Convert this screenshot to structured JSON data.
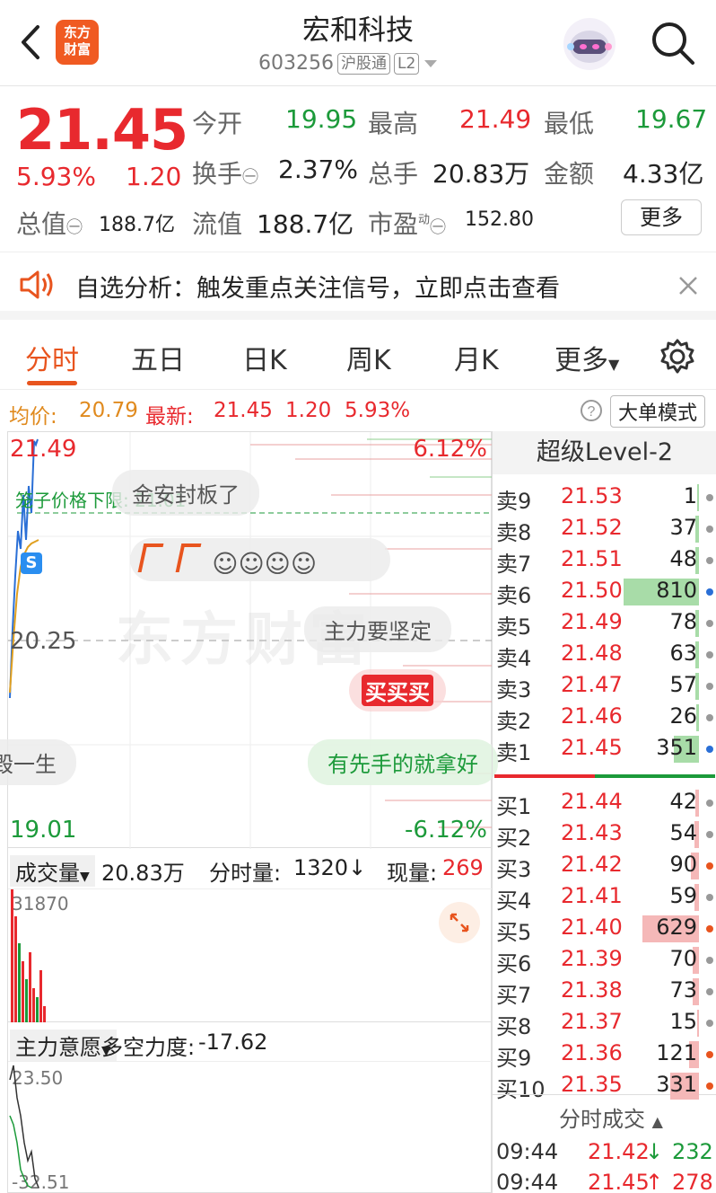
{
  "header": {
    "logo_text": "东方财富",
    "title": "宏和科技",
    "code": "603256",
    "tag_market": "沪股通",
    "tag_level": "L2"
  },
  "quote": {
    "price": "21.45",
    "change_pct": "5.93%",
    "change": "1.20",
    "open_label": "今开",
    "open": "19.95",
    "high_label": "最高",
    "high": "21.49",
    "low_label": "最低",
    "low": "19.67",
    "turnover_label": "换手",
    "turnover": "2.37%",
    "volume_label": "总手",
    "volume": "20.83万",
    "amount_label": "金额",
    "amount": "4.33亿",
    "mktcap_label": "总值",
    "mktcap": "188.7亿",
    "float_label": "流值",
    "float": "188.7亿",
    "pe_label": "市盈",
    "pe_sup": "动",
    "pe": "152.80",
    "more_label": "更多"
  },
  "notice": {
    "text": "自选分析：触发重点关注信号，立即点击查看"
  },
  "tabs": [
    {
      "label": "分时"
    },
    {
      "label": "五日"
    },
    {
      "label": "日K"
    },
    {
      "label": "周K"
    },
    {
      "label": "月K"
    },
    {
      "label": "更多"
    }
  ],
  "infobar": {
    "avg_label": "均价:",
    "avg": "20.79",
    "latest_label": "最新:",
    "latest": "21.45",
    "change": "1.20",
    "change_pct": "5.93%",
    "mode_label": "大单模式"
  },
  "chart": {
    "price_high": "21.49",
    "price_mid": "20.25",
    "price_low": "19.01",
    "pct_high": "6.12%",
    "pct_low": "-6.12%",
    "limit_line_text": "笼子价格下限: 21.01",
    "barrage": [
      "金安封板了",
      "主力要坚定",
      "买买买",
      "有先手的就拿好",
      "毁一生"
    ],
    "s_marker": "S",
    "watermark": "东方财富"
  },
  "volume_panel": {
    "selector": "成交量",
    "total": "20.83万",
    "minute_label": "分时量:",
    "minute": "1320",
    "current_label": "现量:",
    "current": "269",
    "max_label": "31870"
  },
  "indicator_panel": {
    "selector": "主力意愿",
    "strength_label": "多空力度:",
    "strength": "-17.62",
    "top_label": "23.50",
    "bottom_label": "-32.51"
  },
  "level2": {
    "title": "超级Level-2",
    "asks": [
      {
        "label": "卖9",
        "price": "21.53",
        "vol": "1",
        "bar_fraction": 0.0,
        "dot": "gray"
      },
      {
        "label": "卖8",
        "price": "21.52",
        "vol": "37",
        "bar_fraction": 0.03,
        "dot": "gray"
      },
      {
        "label": "卖7",
        "price": "21.51",
        "vol": "48",
        "bar_fraction": 0.03,
        "dot": "gray"
      },
      {
        "label": "卖6",
        "price": "21.50",
        "vol": "810",
        "bar_fraction": 0.6,
        "dot": "blue"
      },
      {
        "label": "卖5",
        "price": "21.49",
        "vol": "78",
        "bar_fraction": 0.03,
        "dot": "gray"
      },
      {
        "label": "卖4",
        "price": "21.48",
        "vol": "63",
        "bar_fraction": 0.03,
        "dot": "gray"
      },
      {
        "label": "卖3",
        "price": "21.47",
        "vol": "57",
        "bar_fraction": 0.03,
        "dot": "gray"
      },
      {
        "label": "卖2",
        "price": "21.46",
        "vol": "26",
        "bar_fraction": 0.02,
        "dot": "gray"
      },
      {
        "label": "卖1",
        "price": "21.45",
        "vol": "351",
        "bar_fraction": 0.2,
        "dot": "blue"
      }
    ],
    "bids": [
      {
        "label": "买1",
        "price": "21.44",
        "vol": "42",
        "bar_fraction": 0.02,
        "dot": "gray"
      },
      {
        "label": "买2",
        "price": "21.43",
        "vol": "54",
        "bar_fraction": 0.03,
        "dot": "gray"
      },
      {
        "label": "买3",
        "price": "21.42",
        "vol": "90",
        "bar_fraction": 0.05,
        "dot": "orange"
      },
      {
        "label": "买4",
        "price": "21.41",
        "vol": "59",
        "bar_fraction": 0.03,
        "dot": "gray"
      },
      {
        "label": "买5",
        "price": "21.40",
        "vol": "629",
        "bar_fraction": 0.35,
        "dot": "orange"
      },
      {
        "label": "买6",
        "price": "21.39",
        "vol": "70",
        "bar_fraction": 0.04,
        "dot": "gray"
      },
      {
        "label": "买7",
        "price": "21.38",
        "vol": "73",
        "bar_fraction": 0.04,
        "dot": "gray"
      },
      {
        "label": "买8",
        "price": "21.37",
        "vol": "15",
        "bar_fraction": 0.01,
        "dot": "gray"
      },
      {
        "label": "买9",
        "price": "21.36",
        "vol": "121",
        "bar_fraction": 0.06,
        "dot": "orange"
      },
      {
        "label": "买10",
        "price": "21.35",
        "vol": "331",
        "bar_fraction": 0.18,
        "dot": "orange"
      }
    ],
    "ticks_title": "分时成交",
    "ticks": [
      {
        "time": "09:44",
        "price": "21.42",
        "dir": "↓",
        "vol": "232"
      },
      {
        "time": "09:44",
        "price": "21.45",
        "dir": "↑",
        "vol": "278"
      }
    ]
  },
  "colors": {
    "up": "#e8292e",
    "down": "#1c9a3a",
    "accent": "#e8541e",
    "avg": "#e0a020"
  }
}
